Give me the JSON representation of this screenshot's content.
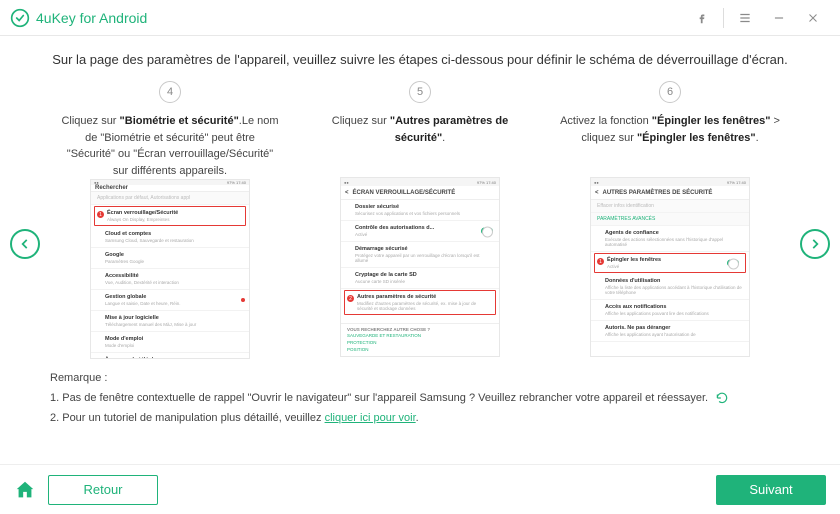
{
  "app": {
    "title": "4uKey for Android"
  },
  "page": {
    "title": "Sur la page des paramètres de l'appareil, veuillez suivre les étapes ci-dessous pour définir le schéma de déverrouillage d'écran."
  },
  "steps": [
    {
      "num": "4",
      "text_pre": "Cliquez sur ",
      "text_bold": "\"Biométrie et sécurité\"",
      "text_post": ".Le nom de \"Biométrie et sécurité\" peut être \"Sécurité\" ou \"Écran verrouillage/Sécurité\" sur différents appareils.",
      "shot": {
        "search": "Rechercher",
        "subhead": "Applications par défaut, Autorisations appl",
        "rows": [
          {
            "t": "Écran verrouillage/Sécurité",
            "s": "Always On Display, Empreintes",
            "hl": true,
            "dot": "1"
          },
          {
            "t": "Cloud et comptes",
            "s": "Samsung Cloud, Sauvegarde et restauration"
          },
          {
            "t": "Google",
            "s": "Paramètres Google"
          },
          {
            "t": "Accessibilité",
            "s": "Vue, Audition, Dextérité et interaction"
          },
          {
            "t": "Gestion globale",
            "s": "Langue et saisie, Date et heure, Réin.",
            "reddot": true
          },
          {
            "t": "Mise à jour logicielle",
            "s": "Téléchargement manuel des MàJ, Mise à jour"
          },
          {
            "t": "Mode d'emploi",
            "s": "Mode d'emploi"
          },
          {
            "t": "À propos du téléphone",
            "s": ""
          }
        ]
      }
    },
    {
      "num": "5",
      "text_pre": "Cliquez sur ",
      "text_bold": "\"Autres paramètres de sécurité\"",
      "text_post": ".",
      "shot": {
        "header": "ÉCRAN VERROUILLAGE/SÉCURITÉ",
        "rows": [
          {
            "t": "Dossier sécurisé",
            "s": "Sécurisez vos applications et vos fichiers personnels"
          },
          {
            "t": "Contrôle des autorisations d...",
            "s": "Activé",
            "toggle": true
          },
          {
            "t": "Démarrage sécurisé",
            "s": "Protégez votre appareil par un verrouillage d'écran lorsqu'il est allumé"
          },
          {
            "t": "Cryptage de la carte SD",
            "s": "Aucune carte SD insérée"
          },
          {
            "t": "Autres paramètres de sécurité",
            "s": "Modifiez d'autres paramètres de sécurité, ex. mise à jour de sécurité et stockage données",
            "hl": true,
            "dot": "2"
          }
        ],
        "footer_label": "VOUS RECHERCHEZ AUTRE CHOSE ?",
        "footer_items": [
          "SAUVEGARDE ET RESTAURATION",
          "PROTECTION",
          "POSITION"
        ]
      }
    },
    {
      "num": "6",
      "text_pre": "Activez la fonction ",
      "text_bold": "\"Épingler les fenêtres\"",
      "text_mid": " > cliquez sur ",
      "text_bold2": "\"Épingler les fenêtres\"",
      "text_post": ".",
      "shot": {
        "header": "AUTRES PARAMÈTRES DE SÉCURITÉ",
        "grey1": "Effacer infos identification",
        "section": "PARAMÈTRES AVANCÉS",
        "rows": [
          {
            "t": "Agents de confiance",
            "s": "Exécute des actions sélectionnées sans l'historique d'appel automatisé"
          },
          {
            "t": "Épingler les fenêtres",
            "s": "Activé",
            "toggle": true,
            "hl": true,
            "dot": "1"
          },
          {
            "t": "Données d'utilisation",
            "s": "Affiche la liste des applications accédant à l'historique d'utilisation de votre téléphone"
          },
          {
            "t": "Accès aux notifications",
            "s": "Affiche les applications pouvant lire des notifications"
          },
          {
            "t": "Autoris. Ne pas déranger",
            "s": "Affiche les applications ayant l'autorisation de"
          }
        ]
      }
    }
  ],
  "remark": {
    "label": "Remarque :",
    "line1": "1. Pas de fenêtre contextuelle de rappel \"Ouvrir le navigateur\" sur l'appareil Samsung ? Veuillez rebrancher votre appareil et réessayer.",
    "line2_pre": "2. Pour un tutoriel de manipulation plus détaillé, veuillez ",
    "line2_link": "cliquer ici pour voir",
    "line2_post": "."
  },
  "footer": {
    "back": "Retour",
    "next": "Suivant"
  },
  "shot_status": {
    "time": "17:40",
    "signal": "97%"
  }
}
